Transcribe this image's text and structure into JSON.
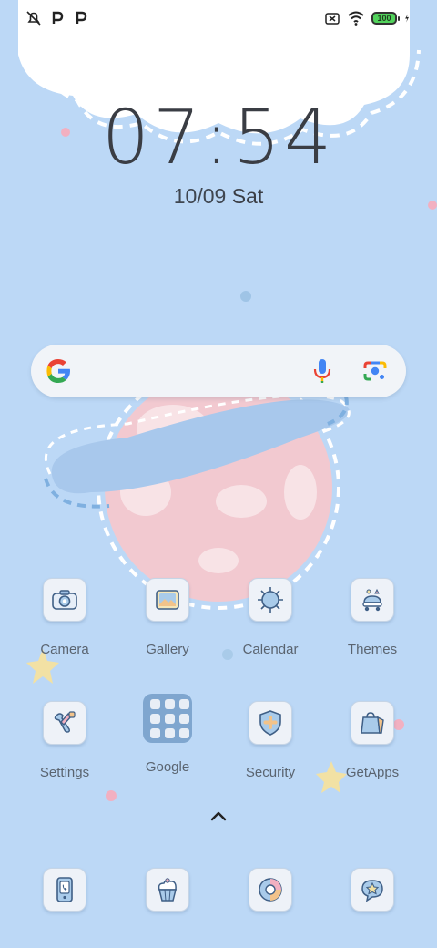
{
  "status_bar": {
    "left_icons": [
      "notifications-muted-icon",
      "parking-p-icon",
      "parking-p-icon"
    ],
    "right_icons": [
      "no-sim-icon",
      "wifi-icon",
      "battery-icon",
      "charging-bolt-icon"
    ],
    "battery_level": "100"
  },
  "lock_clock": {
    "time": "07:54",
    "date": "10/09",
    "day": "Sat"
  },
  "search": {
    "icons": [
      "google-g-icon",
      "mic-icon",
      "lens-icon"
    ]
  },
  "apps": [
    {
      "label": "Camera",
      "icon": "camera-icon"
    },
    {
      "label": "Gallery",
      "icon": "gallery-icon"
    },
    {
      "label": "Calendar",
      "icon": "sun-calendar-icon"
    },
    {
      "label": "Themes",
      "icon": "themes-icon"
    },
    {
      "label": "Settings",
      "icon": "settings-icon"
    },
    {
      "label": "Google",
      "icon": "google-folder-icon"
    },
    {
      "label": "Security",
      "icon": "security-shield-icon"
    },
    {
      "label": "GetApps",
      "icon": "getapps-bag-icon"
    }
  ],
  "dock": [
    {
      "icon": "phone-icon"
    },
    {
      "icon": "cupcake-icon"
    },
    {
      "icon": "browser-icon"
    },
    {
      "icon": "messages-star-icon"
    }
  ],
  "drawer_hint_icon": "chevron-up-icon",
  "colors": {
    "background": "#bcd8f6",
    "cloud": "#ffffff",
    "planet": "#f2c9d0",
    "ring": "#a8c8ec",
    "star": "#f2e1a4"
  }
}
